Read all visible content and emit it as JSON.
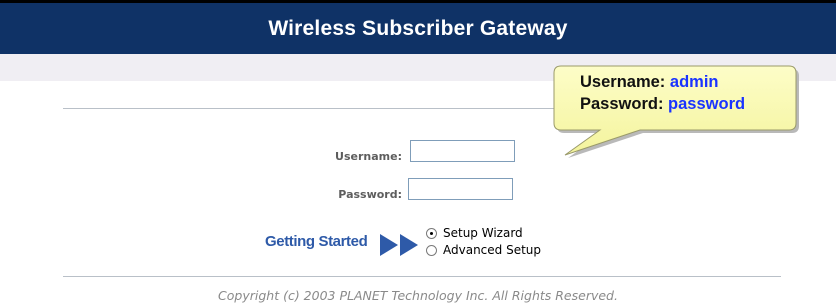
{
  "header": {
    "title": "Wireless Subscriber Gateway"
  },
  "login": {
    "username_label": "Username:",
    "password_label": "Password:",
    "username_value": "",
    "password_value": ""
  },
  "getting_started": {
    "label": "Getting Started",
    "options": [
      {
        "label": "Setup Wizard",
        "selected": true
      },
      {
        "label": "Advanced Setup",
        "selected": false
      }
    ]
  },
  "callout": {
    "username_label": "Username:",
    "username_value": "admin",
    "password_label": "Password:",
    "password_value": "password"
  },
  "footer": {
    "copyright": "Copyright (c) 2003 PLANET Technology Inc. All Rights Reserved."
  },
  "colors": {
    "title_bar": "#0f3266",
    "getting_started": "#2e5aa8",
    "callout_fill": "#fbfbb5",
    "credential_value": "#1a33ff"
  },
  "icons": {
    "arrows": "double-right-arrow-icon"
  }
}
